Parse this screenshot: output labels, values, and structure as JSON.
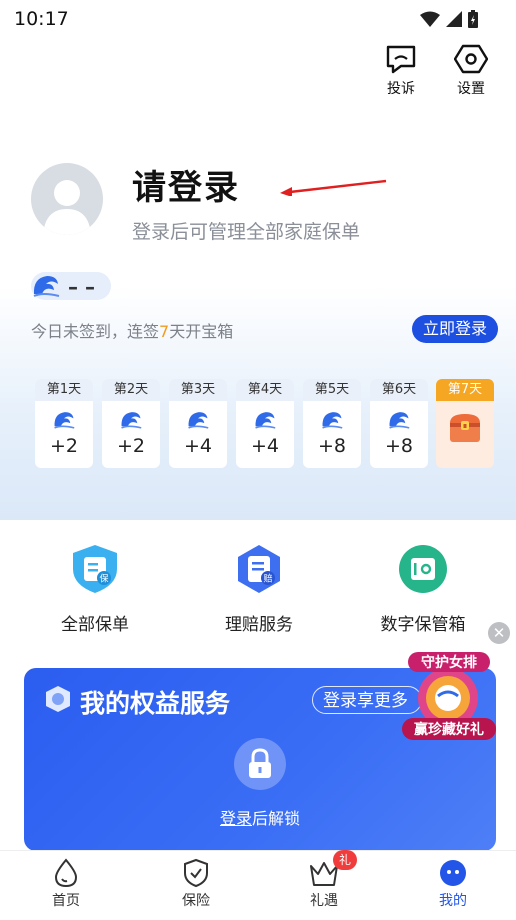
{
  "status_bar": {
    "time": "10:17"
  },
  "header": {
    "complaint_label": "投诉",
    "settings_label": "设置"
  },
  "profile": {
    "title": "请登录",
    "subtitle": "登录后可管理全部家庭保单",
    "points": "– –"
  },
  "sign_in": {
    "text_prefix": "今日未签到，连签",
    "highlight": "7",
    "text_suffix": "天开宝箱",
    "login_button": "立即登录",
    "days": [
      {
        "label": "第1天",
        "value": "+2"
      },
      {
        "label": "第2天",
        "value": "+2"
      },
      {
        "label": "第3天",
        "value": "+4"
      },
      {
        "label": "第4天",
        "value": "+4"
      },
      {
        "label": "第5天",
        "value": "+8"
      },
      {
        "label": "第6天",
        "value": "+8"
      },
      {
        "label": "第7天",
        "value": ""
      }
    ]
  },
  "features": [
    {
      "label": "全部保单",
      "icon": "policy-icon",
      "badge": "保"
    },
    {
      "label": "理赔服务",
      "icon": "claims-icon",
      "badge": "赔"
    },
    {
      "label": "数字保管箱",
      "icon": "safe-box-icon"
    }
  ],
  "rights": {
    "title": "我的权益服务",
    "more_button": "登录享更多",
    "unlock_link": "登录",
    "unlock_suffix": "后解锁"
  },
  "promo": {
    "line1": "守护女排",
    "line2": "赢珍藏好礼"
  },
  "nav": {
    "home": "首页",
    "insurance": "保险",
    "gifts": "礼遇",
    "gift_badge": "礼",
    "mine": "我的"
  },
  "colors": {
    "accent": "#1d4fe0",
    "highlight": "#f39b1e",
    "card": "#2b5df0"
  }
}
